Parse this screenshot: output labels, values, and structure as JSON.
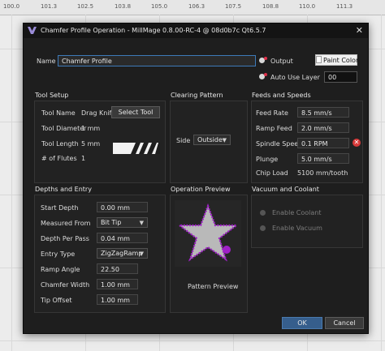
{
  "ruler": {
    "ticks": [
      "100.0",
      "101.3",
      "102.5",
      "103.8",
      "105.0",
      "106.3",
      "107.5",
      "108.8",
      "110.0",
      "111.3"
    ]
  },
  "window": {
    "title": "Chamfer Profile Operation - MillMage 0.8.00-RC-4 @ 08d0b7c Qt6.5.7",
    "close_symbol": "✕"
  },
  "name_row": {
    "label": "Name",
    "value": "Chamfer Profile",
    "output_label": "Output",
    "paint_color_label": "Paint Color",
    "auto_layer_label": "Auto Use Layer",
    "layer_value": "00"
  },
  "tool_setup": {
    "title": "Tool Setup",
    "tool_name_label": "Tool Name",
    "tool_name_value": "Drag Knife",
    "select_tool_label": "Select Tool",
    "diameter_label": "Tool Diameter",
    "diameter_value": "1 mm",
    "length_label": "Tool Length",
    "length_value": "5 mm",
    "flutes_label": "# of Flutes",
    "flutes_value": "1"
  },
  "clearing": {
    "title": "Clearing Pattern",
    "side_label": "Side",
    "side_value": "Outside"
  },
  "feeds": {
    "title": "Feeds and Speeds",
    "feed_rate_label": "Feed Rate",
    "feed_rate_value": "8.5 mm/s",
    "ramp_feed_label": "Ramp Feed",
    "ramp_feed_value": "2.0 mm/s",
    "spindle_label": "Spindle Speed",
    "spindle_value": "0.1 RPM",
    "plunge_label": "Plunge",
    "plunge_value": "5.0 mm/s",
    "chip_load_label": "Chip Load",
    "chip_load_value": "5100 mm/tooth"
  },
  "depths": {
    "title": "Depths and Entry",
    "start_depth_label": "Start Depth",
    "start_depth_value": "0.00 mm",
    "measured_label": "Measured From",
    "measured_value": "Bit Tip",
    "depth_pass_label": "Depth Per Pass",
    "depth_pass_value": "0.04 mm",
    "entry_label": "Entry Type",
    "entry_value": "ZigZagRamp",
    "ramp_angle_label": "Ramp Angle",
    "ramp_angle_value": "22.50",
    "chamfer_width_label": "Chamfer Width",
    "chamfer_width_value": "1.00 mm",
    "tip_offset_label": "Tip Offset",
    "tip_offset_value": "1.00 mm"
  },
  "preview": {
    "title": "Operation Preview",
    "caption": "Pattern Preview"
  },
  "vacuum": {
    "title": "Vacuum and Coolant",
    "coolant_label": "Enable Coolant",
    "vacuum_label": "Enable Vacuum"
  },
  "footer": {
    "ok_label": "OK",
    "cancel_label": "Cancel"
  },
  "colors": {
    "accent": "#3d7ab8",
    "star_fill": "#b9b9b9",
    "star_outline": "#a020c8"
  }
}
